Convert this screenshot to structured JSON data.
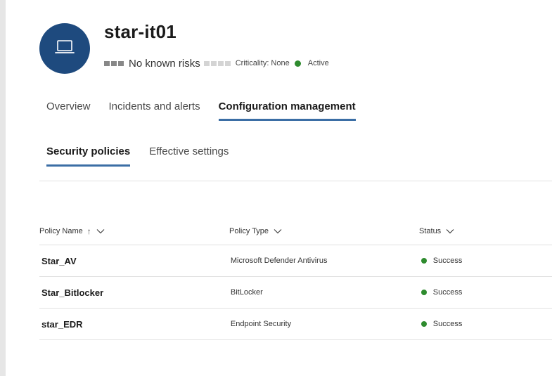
{
  "device": {
    "name": "star-it01",
    "risk_label": "No known risks",
    "criticality_label": "Criticality: None",
    "status_label": "Active",
    "status_color": "#2e8b2e",
    "avatar_color": "#1e4a7e",
    "avatar_icon": "laptop-icon"
  },
  "tabs": [
    {
      "label": "Overview",
      "selected": false
    },
    {
      "label": "Incidents and alerts",
      "selected": false
    },
    {
      "label": "Configuration management",
      "selected": true
    }
  ],
  "subtabs": [
    {
      "label": "Security policies",
      "selected": true
    },
    {
      "label": "Effective settings",
      "selected": false
    }
  ],
  "table": {
    "columns": [
      {
        "label": "Policy Name",
        "sort": "ascending"
      },
      {
        "label": "Policy Type"
      },
      {
        "label": "Status"
      }
    ],
    "rows": [
      {
        "name": "Star_AV",
        "type": "Microsoft Defender Antivirus",
        "status": "Success"
      },
      {
        "name": "Star_Bitlocker",
        "type": "BitLocker",
        "status": "Success"
      },
      {
        "name": "star_EDR",
        "type": "Endpoint Security",
        "status": "Success"
      }
    ]
  },
  "colors": {
    "accent": "#3b6ea5",
    "success": "#2e8b2e"
  }
}
